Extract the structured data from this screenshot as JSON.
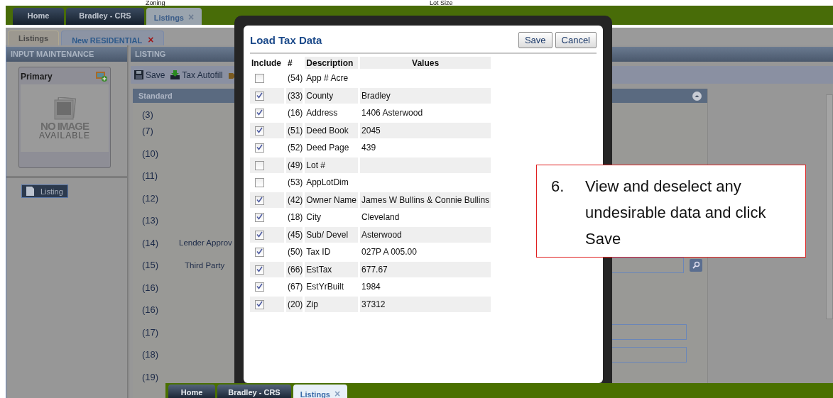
{
  "top_strip": {
    "labels": [
      "Zoning",
      "Lot Size"
    ]
  },
  "main_tabs": [
    {
      "label": "Home",
      "selected": false
    },
    {
      "label": "Bradley - CRS",
      "selected": false
    },
    {
      "label": "Listings",
      "selected": true,
      "close": "×"
    }
  ],
  "sub_tabs": [
    {
      "label": "Listings",
      "selected": false
    },
    {
      "label": "New RESIDENTIAL",
      "selected": true,
      "close": "×"
    }
  ],
  "input_maintenance": {
    "title": "INPUT MAINTENANCE",
    "photo_card": {
      "title": "Primary",
      "no_image": "NO IMAGE",
      "available": "AVAILABLE"
    },
    "nav": [
      {
        "label": "Listing",
        "selected": true
      }
    ]
  },
  "listing": {
    "title": "LISTING",
    "toolbar": [
      {
        "kind": "save",
        "label": "Save"
      },
      {
        "kind": "autofill",
        "label": "Tax Autofill"
      },
      {
        "kind": "other"
      }
    ],
    "section": "Standard",
    "rows": [
      {
        "kind": "plain",
        "number": "(3)"
      },
      {
        "kind": "plain",
        "number": "(7)"
      },
      {
        "kind": "plain",
        "number": "(10)"
      },
      {
        "kind": "plain",
        "number": "(11)"
      },
      {
        "kind": "plain",
        "number": "(12)"
      },
      {
        "kind": "plain",
        "number": "(13)"
      },
      {
        "kind": "plain",
        "number": "(14)",
        "label": "Lender Approv"
      },
      {
        "kind": "search",
        "number": "(15)",
        "label": "Third Party"
      },
      {
        "kind": "plain",
        "number": "(16)"
      },
      {
        "kind": "plain",
        "number": "(16)"
      },
      {
        "kind": "text",
        "number": "(17)"
      },
      {
        "kind": "text",
        "number": "(18)"
      },
      {
        "kind": "plain",
        "number": "(19)"
      }
    ]
  },
  "dialog": {
    "title": "Load Tax Data",
    "buttons": [
      "Save",
      "Cancel"
    ],
    "columns": [
      "Include",
      "#",
      "Description",
      "Values"
    ],
    "rows": [
      {
        "checked": false,
        "number": "(54)",
        "description": "App # Acre"
      },
      {
        "checked": true,
        "number": "(33)",
        "description": "County",
        "value": "Bradley"
      },
      {
        "checked": true,
        "number": "(16)",
        "description": "Address",
        "value": "1406 Asterwood"
      },
      {
        "checked": true,
        "number": "(51)",
        "description": "Deed Book",
        "value": "2045"
      },
      {
        "checked": true,
        "number": "(52)",
        "description": "Deed Page",
        "value": "439"
      },
      {
        "checked": false,
        "number": "(49)",
        "description": "Lot #"
      },
      {
        "checked": false,
        "number": "(53)",
        "description": "AppLotDim"
      },
      {
        "checked": true,
        "number": "(42)",
        "description": "Owner Name",
        "value": "James W Bullins & Connie Bullins"
      },
      {
        "checked": true,
        "number": "(18)",
        "description": "City",
        "value": "Cleveland"
      },
      {
        "checked": true,
        "number": "(45)",
        "description": "Sub/ Devel",
        "value": "Asterwood"
      },
      {
        "checked": true,
        "number": "(50)",
        "description": "Tax ID",
        "value": "027P A 005.00"
      },
      {
        "checked": true,
        "number": "(66)",
        "description": "EstTax",
        "value": "677.67"
      },
      {
        "checked": true,
        "number": "(67)",
        "description": "EstYrBuilt",
        "value": "1984"
      },
      {
        "checked": true,
        "number": "(20)",
        "description": "Zip",
        "value": "37312"
      }
    ]
  },
  "bottom_tabs": [
    {
      "label": "Home",
      "selected": false
    },
    {
      "label": "Bradley - CRS",
      "selected": false
    },
    {
      "label": "Listings",
      "selected": true,
      "close": "×"
    }
  ],
  "callout": {
    "number": "6.",
    "text": "View and deselect any undesirable data and click Save"
  }
}
